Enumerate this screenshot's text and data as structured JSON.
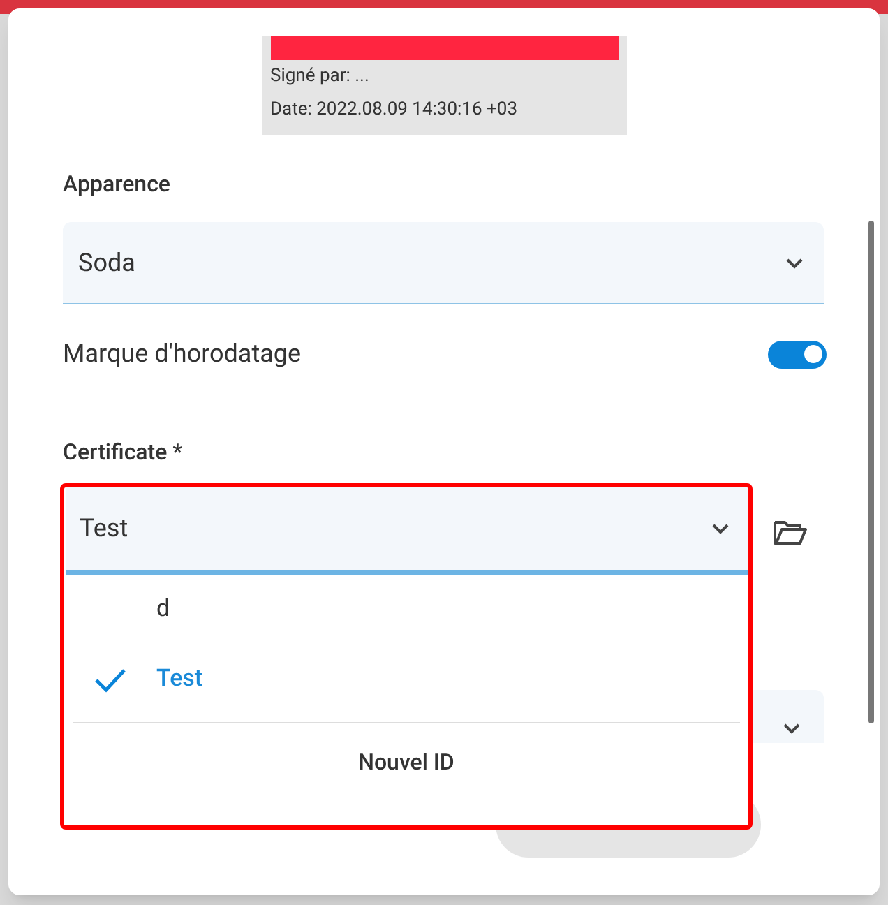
{
  "signature": {
    "signed_by": "Signé par: ...",
    "date": "Date: 2022.08.09 14:30:16 +03"
  },
  "appearance": {
    "label": "Apparence",
    "value": "Soda"
  },
  "timestamp": {
    "label": "Marque d'horodatage",
    "on": true
  },
  "certificate": {
    "label": "Certificate *",
    "value": "Test",
    "expanded": true,
    "options": [
      {
        "label": "d",
        "selected": false
      },
      {
        "label": "Test",
        "selected": true
      }
    ],
    "action": "Nouvel ID"
  }
}
